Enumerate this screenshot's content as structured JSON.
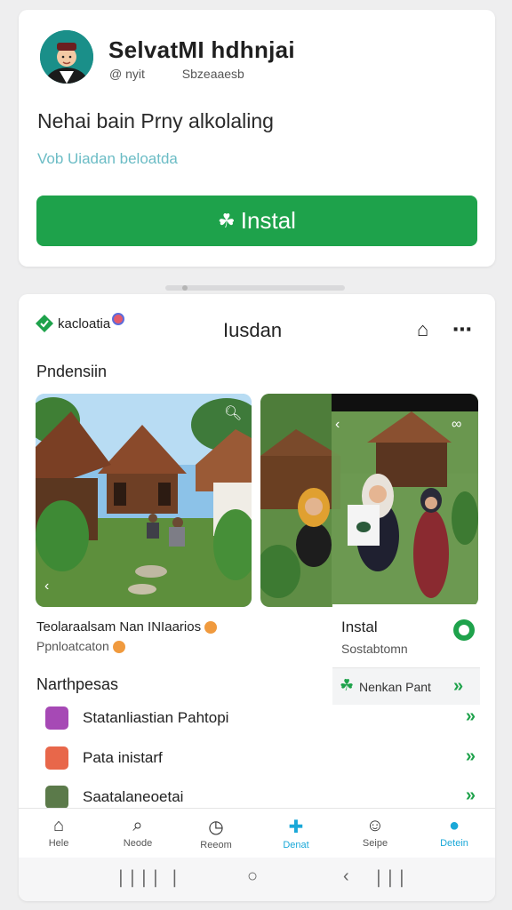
{
  "header": {
    "app_name": "SelvatMI hdhnjai",
    "developer": "@ nyit",
    "category": "Sbzeaaesb",
    "headline": "Nehai bain Prny alkolaling",
    "link": "Vob Uiadan beloatda",
    "install_label": "Instal",
    "install_icon": "leaf-icon"
  },
  "toolbar": {
    "brand": "kacloatia",
    "title": "Iusdan",
    "share_icon": "share-icon",
    "more_icon": "more-icon"
  },
  "screenshots": {
    "section_label": "Pndensiin",
    "caption": "Teolaraalsam Nan INIaarios",
    "sub_caption": "Ppnloatcaton"
  },
  "popup": {
    "title": "Instal",
    "subtitle": "Sostabtomn",
    "row_label": "Nenkan Pant"
  },
  "list": {
    "section_label": "Narthpesas",
    "items": [
      {
        "label": "Statanliastian Pahtopi",
        "icon": "check-icon",
        "color": "#a649b5"
      },
      {
        "label": "Pata inistarf",
        "icon": "play-icon",
        "color": "#e8674a"
      },
      {
        "label": "Saatalaneoetai",
        "icon": "app-icon",
        "color": "#5b7a4a"
      }
    ]
  },
  "nav": [
    {
      "label": "Hele",
      "icon": "home-icon"
    },
    {
      "label": "Neode",
      "icon": "search-icon"
    },
    {
      "label": "Reeom",
      "icon": "clock-icon"
    },
    {
      "label": "Denat",
      "icon": "add-icon",
      "active": true
    },
    {
      "label": "Seipe",
      "icon": "face-icon"
    },
    {
      "label": "Detein",
      "icon": "person-icon",
      "active": true
    }
  ],
  "colors": {
    "primary_green": "#1ea24b",
    "link_blue": "#6bbcc5",
    "accent_blue": "#1aa8d8"
  }
}
